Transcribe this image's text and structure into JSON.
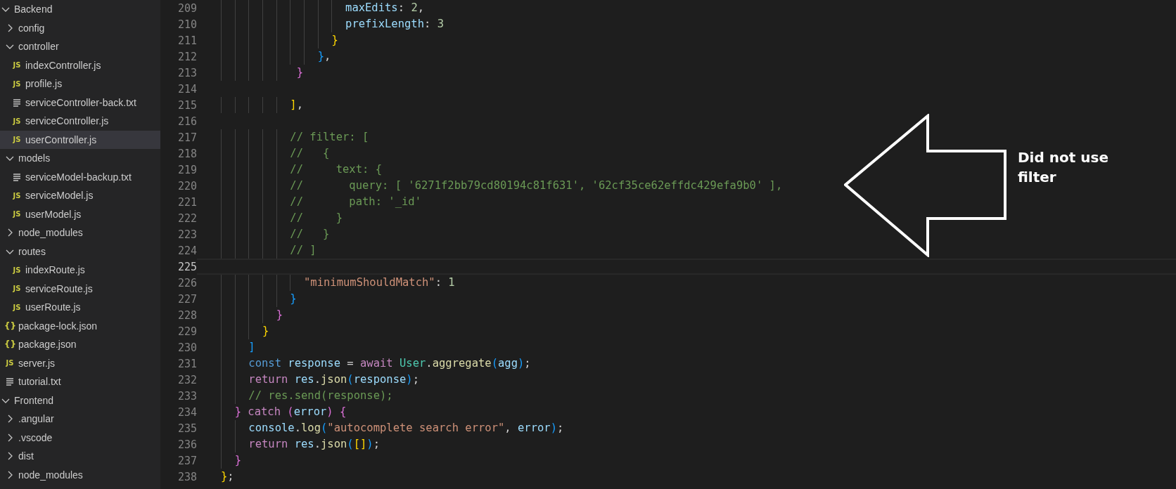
{
  "sidebar": {
    "tree": [
      {
        "kind": "folder",
        "name": "Backend",
        "expanded": true,
        "selected": false,
        "children": [
          {
            "kind": "folder",
            "name": "config",
            "expanded": false,
            "selected": false
          },
          {
            "kind": "folder",
            "name": "controller",
            "expanded": true,
            "selected": false,
            "children": [
              {
                "kind": "js",
                "icon_text": "JS",
                "name": "indexController.js",
                "selected": false
              },
              {
                "kind": "js",
                "icon_text": "JS",
                "name": "profile.js",
                "selected": false
              },
              {
                "kind": "text",
                "name": "serviceController-back.txt",
                "selected": false
              },
              {
                "kind": "js",
                "icon_text": "JS",
                "name": "serviceController.js",
                "selected": false
              },
              {
                "kind": "js",
                "icon_text": "JS",
                "name": "userController.js",
                "selected": true
              }
            ]
          },
          {
            "kind": "folder",
            "name": "models",
            "expanded": true,
            "selected": false,
            "children": [
              {
                "kind": "text",
                "name": "serviceModel-backup.txt",
                "selected": false
              },
              {
                "kind": "js",
                "icon_text": "JS",
                "name": "serviceModel.js",
                "selected": false
              },
              {
                "kind": "js",
                "icon_text": "JS",
                "name": "userModel.js",
                "selected": false
              }
            ]
          },
          {
            "kind": "folder",
            "name": "node_modules",
            "expanded": false,
            "selected": false
          },
          {
            "kind": "folder",
            "name": "routes",
            "expanded": true,
            "selected": false,
            "children": [
              {
                "kind": "js",
                "icon_text": "JS",
                "name": "indexRoute.js",
                "selected": false
              },
              {
                "kind": "js",
                "icon_text": "JS",
                "name": "serviceRoute.js",
                "selected": false
              },
              {
                "kind": "js",
                "icon_text": "JS",
                "name": "userRoute.js",
                "selected": false
              }
            ]
          },
          {
            "kind": "json",
            "icon_text": "{}",
            "name": "package-lock.json",
            "selected": false
          },
          {
            "kind": "json",
            "icon_text": "{}",
            "name": "package.json",
            "selected": false
          },
          {
            "kind": "js",
            "icon_text": "JS",
            "name": "server.js",
            "selected": false
          },
          {
            "kind": "text",
            "name": "tutorial.txt",
            "selected": false
          }
        ]
      },
      {
        "kind": "folder",
        "name": "Frontend",
        "expanded": true,
        "selected": false,
        "children": [
          {
            "kind": "folder",
            "name": ".angular",
            "expanded": false,
            "selected": false
          },
          {
            "kind": "folder",
            "name": ".vscode",
            "expanded": false,
            "selected": false
          },
          {
            "kind": "folder",
            "name": "dist",
            "expanded": false,
            "selected": false
          },
          {
            "kind": "folder",
            "name": "node_modules",
            "expanded": false,
            "selected": false
          }
        ]
      }
    ]
  },
  "editor": {
    "lines": [
      {
        "number": "209",
        "current": false,
        "tokens": [
          {
            "kind": "prop",
            "text": "                  maxEdits"
          },
          {
            "kind": "punct",
            "text": ": "
          },
          {
            "kind": "num",
            "text": "2"
          },
          {
            "kind": "punct",
            "text": ","
          }
        ]
      },
      {
        "number": "210",
        "current": false,
        "tokens": [
          {
            "kind": "prop",
            "text": "                  prefixLength"
          },
          {
            "kind": "punct",
            "text": ": "
          },
          {
            "kind": "num",
            "text": "3"
          }
        ]
      },
      {
        "number": "211",
        "current": false,
        "tokens": [
          {
            "kind": "gold",
            "text": "                }"
          }
        ]
      },
      {
        "number": "212",
        "current": false,
        "tokens": [
          {
            "kind": "blue",
            "text": "              }"
          },
          {
            "kind": "punct",
            "text": ","
          }
        ]
      },
      {
        "number": "213",
        "current": false,
        "tokens": [
          {
            "kind": "pink",
            "text": "           }"
          }
        ]
      },
      {
        "number": "214",
        "current": false
      },
      {
        "number": "215",
        "current": false,
        "tokens": [
          {
            "kind": "gold",
            "text": "          ]"
          },
          {
            "kind": "punct",
            "text": ","
          }
        ]
      },
      {
        "number": "216",
        "current": false
      },
      {
        "number": "217",
        "current": false,
        "tokens": [
          {
            "kind": "comment",
            "text": "          // filter: ["
          }
        ]
      },
      {
        "number": "218",
        "current": false,
        "tokens": [
          {
            "kind": "comment",
            "text": "          //   {"
          }
        ]
      },
      {
        "number": "219",
        "current": false,
        "tokens": [
          {
            "kind": "comment",
            "text": "          //     text: {"
          }
        ]
      },
      {
        "number": "220",
        "current": false,
        "tokens": [
          {
            "kind": "comment",
            "text": "          //       query: [ '6271f2bb79cd80194c81f631', '62cf35ce62effdc429efa9b0' ],"
          }
        ]
      },
      {
        "number": "221",
        "current": false,
        "tokens": [
          {
            "kind": "comment",
            "text": "          //       path: '_id'"
          }
        ]
      },
      {
        "number": "222",
        "current": false,
        "tokens": [
          {
            "kind": "comment",
            "text": "          //     }"
          }
        ]
      },
      {
        "number": "223",
        "current": false,
        "tokens": [
          {
            "kind": "comment",
            "text": "          //   }"
          }
        ]
      },
      {
        "number": "224",
        "current": false,
        "tokens": [
          {
            "kind": "comment",
            "text": "          // ]"
          }
        ]
      },
      {
        "number": "225",
        "current": true
      },
      {
        "number": "226",
        "current": false,
        "tokens": [
          {
            "kind": "string",
            "text": "            \"minimumShouldMatch\""
          },
          {
            "kind": "punct",
            "text": ": "
          },
          {
            "kind": "num",
            "text": "1"
          }
        ]
      },
      {
        "number": "227",
        "current": false,
        "tokens": [
          {
            "kind": "blue",
            "text": "          }"
          }
        ]
      },
      {
        "number": "228",
        "current": false,
        "tokens": [
          {
            "kind": "pink",
            "text": "        }"
          }
        ]
      },
      {
        "number": "229",
        "current": false,
        "tokens": [
          {
            "kind": "gold",
            "text": "      }"
          }
        ]
      },
      {
        "number": "230",
        "current": false,
        "tokens": [
          {
            "kind": "blue",
            "text": "    ]"
          }
        ]
      },
      {
        "number": "231",
        "current": false,
        "tokens": [
          {
            "kind": "keyword",
            "text": "    const "
          },
          {
            "kind": "var",
            "text": "response"
          },
          {
            "kind": "punct",
            "text": " = "
          },
          {
            "kind": "control",
            "text": "await "
          },
          {
            "kind": "class",
            "text": "User"
          },
          {
            "kind": "punct",
            "text": "."
          },
          {
            "kind": "func",
            "text": "aggregate"
          },
          {
            "kind": "blue",
            "text": "("
          },
          {
            "kind": "var",
            "text": "agg"
          },
          {
            "kind": "blue",
            "text": ")"
          },
          {
            "kind": "punct",
            "text": ";"
          }
        ]
      },
      {
        "number": "232",
        "current": false,
        "tokens": [
          {
            "kind": "control",
            "text": "    return "
          },
          {
            "kind": "var",
            "text": "res"
          },
          {
            "kind": "punct",
            "text": "."
          },
          {
            "kind": "func",
            "text": "json"
          },
          {
            "kind": "blue",
            "text": "("
          },
          {
            "kind": "var",
            "text": "response"
          },
          {
            "kind": "blue",
            "text": ")"
          },
          {
            "kind": "punct",
            "text": ";"
          }
        ]
      },
      {
        "number": "233",
        "current": false,
        "tokens": [
          {
            "kind": "comment",
            "text": "    // res.send(response);"
          }
        ]
      },
      {
        "number": "234",
        "current": false,
        "tokens": [
          {
            "kind": "pink",
            "text": "  } "
          },
          {
            "kind": "control",
            "text": "catch "
          },
          {
            "kind": "pink",
            "text": "("
          },
          {
            "kind": "var",
            "text": "error"
          },
          {
            "kind": "pink",
            "text": ") {"
          }
        ]
      },
      {
        "number": "235",
        "current": false,
        "tokens": [
          {
            "kind": "var",
            "text": "    console"
          },
          {
            "kind": "punct",
            "text": "."
          },
          {
            "kind": "func",
            "text": "log"
          },
          {
            "kind": "blue",
            "text": "("
          },
          {
            "kind": "string",
            "text": "\"autocomplete search error\""
          },
          {
            "kind": "punct",
            "text": ", "
          },
          {
            "kind": "var",
            "text": "error"
          },
          {
            "kind": "blue",
            "text": ")"
          },
          {
            "kind": "punct",
            "text": ";"
          }
        ]
      },
      {
        "number": "236",
        "current": false,
        "tokens": [
          {
            "kind": "control",
            "text": "    return "
          },
          {
            "kind": "var",
            "text": "res"
          },
          {
            "kind": "punct",
            "text": "."
          },
          {
            "kind": "func",
            "text": "json"
          },
          {
            "kind": "blue",
            "text": "("
          },
          {
            "kind": "gold",
            "text": "[]"
          },
          {
            "kind": "blue",
            "text": ")"
          },
          {
            "kind": "punct",
            "text": ";"
          }
        ]
      },
      {
        "number": "237",
        "current": false,
        "tokens": [
          {
            "kind": "pink",
            "text": "  }"
          }
        ]
      },
      {
        "number": "238",
        "current": false,
        "tokens": [
          {
            "kind": "gold",
            "text": "}"
          },
          {
            "kind": "punct",
            "text": ";"
          }
        ]
      }
    ]
  },
  "annotation": {
    "text": "Did not use filter"
  }
}
